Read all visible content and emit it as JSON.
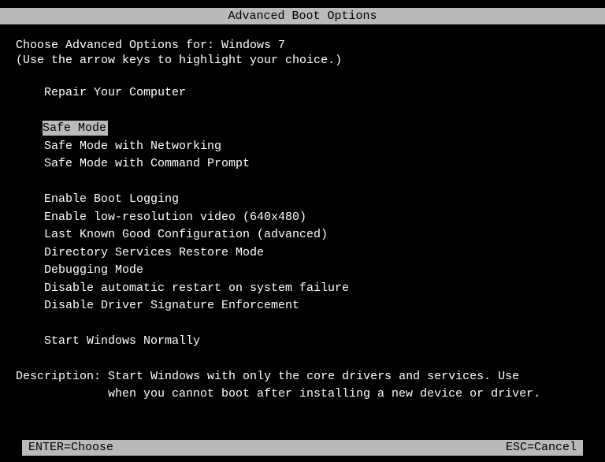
{
  "title": "Advanced Boot Options",
  "header": {
    "line1_prefix": "Choose Advanced Options for: ",
    "line1_os": "Windows 7",
    "line2": "(Use the arrow keys to highlight your choice.)"
  },
  "options": {
    "group1": [
      "Repair Your Computer"
    ],
    "group2": [
      "Safe Mode",
      "Safe Mode with Networking",
      "Safe Mode with Command Prompt"
    ],
    "group3": [
      "Enable Boot Logging",
      "Enable low-resolution video (640x480)",
      "Last Known Good Configuration (advanced)",
      "Directory Services Restore Mode",
      "Debugging Mode",
      "Disable automatic restart on system failure",
      "Disable Driver Signature Enforcement"
    ],
    "group4": [
      "Start Windows Normally"
    ],
    "selected": "Safe Mode"
  },
  "description": {
    "label": "Description: ",
    "line1": "Start Windows with only the core drivers and services. Use",
    "line2": "when you cannot boot after installing a new device or driver."
  },
  "footer": {
    "left": "ENTER=Choose",
    "right": "ESC=Cancel"
  }
}
